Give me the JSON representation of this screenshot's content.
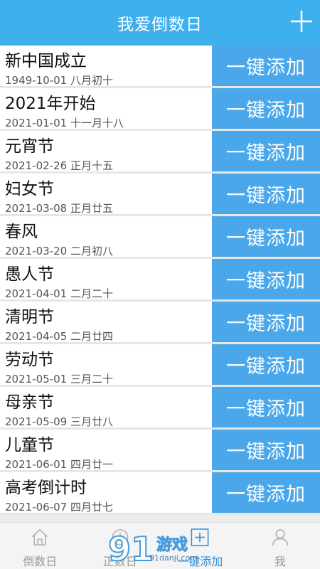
{
  "header": {
    "title": "我爱倒数日",
    "add_icon": "plus-icon"
  },
  "add_label": "一键添加",
  "items": [
    {
      "name": "新中国成立",
      "date": "1949-10-01 八月初十"
    },
    {
      "name": "2021年开始",
      "date": "2021-01-01 十一月十八"
    },
    {
      "name": "元宵节",
      "date": "2021-02-26 正月十五"
    },
    {
      "name": "妇女节",
      "date": "2021-03-08 正月廿五"
    },
    {
      "name": "春风",
      "date": "2021-03-20 二月初八"
    },
    {
      "name": "愚人节",
      "date": "2021-04-01 二月二十"
    },
    {
      "name": "清明节",
      "date": "2021-04-05 二月廿四"
    },
    {
      "name": "劳动节",
      "date": "2021-05-01 三月二十"
    },
    {
      "name": "母亲节",
      "date": "2021-05-09 三月廿八"
    },
    {
      "name": "儿童节",
      "date": "2021-06-01 四月廿一"
    },
    {
      "name": "高考倒计时",
      "date": "2021-06-07 四月廿七"
    }
  ],
  "tabs": [
    {
      "label": "倒数日",
      "icon": "home-icon"
    },
    {
      "label": "正数日",
      "icon": "clock-icon"
    },
    {
      "label": "一键添加",
      "icon": "add-box-icon"
    },
    {
      "label": "我",
      "icon": "user-icon"
    }
  ],
  "watermark": {
    "main": "游戏",
    "sub": "91danji.com"
  },
  "colors": {
    "header": "#3fb0ee",
    "add_button": "#4aa8ea",
    "active_tab": "#2f8fd6"
  }
}
